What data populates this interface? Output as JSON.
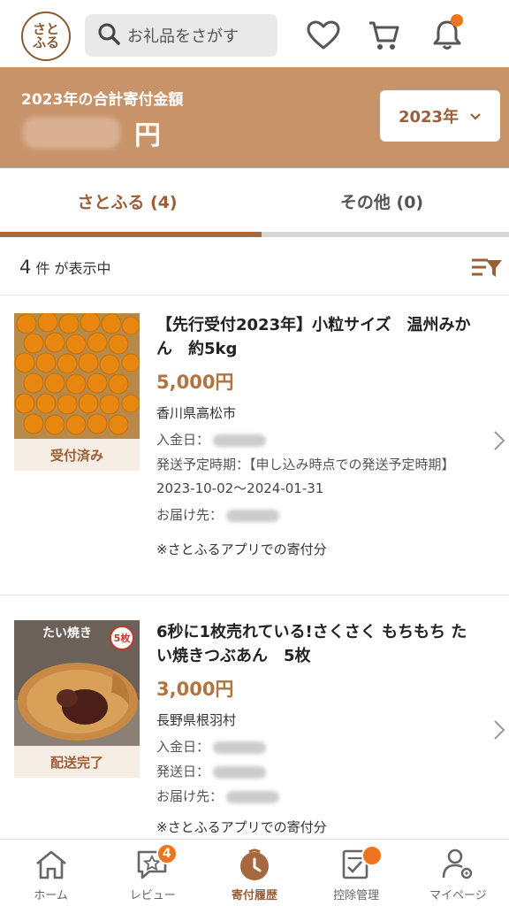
{
  "header": {
    "logo_text": "さとふる",
    "search_placeholder": "お礼品をさがす",
    "icons": [
      "search-icon",
      "heart-icon",
      "cart-icon",
      "bell-icon"
    ]
  },
  "summary": {
    "label": "2023年の合計寄付金額",
    "currency": "円",
    "year_select": "2023年"
  },
  "tabs": [
    {
      "label": "さとふる (4)",
      "active": true
    },
    {
      "label": "その他 (0)",
      "active": false
    }
  ],
  "list": {
    "count": "4",
    "count_suffix": "件 が表示中"
  },
  "items": [
    {
      "title": "【先行受付2023年】小粒サイズ　温州みかん　約5kg",
      "price": "5,000円",
      "municipality": "香川県高松市",
      "status": "受付済み",
      "payment_label": "入金日：",
      "shipping_label": "発送予定時期：【申し込み時点での発送予定時期】",
      "shipping_dates": "2023-10-02〜2024-01-31",
      "delivery_label": "お届け先：",
      "note": "※さとふるアプリでの寄付分"
    },
    {
      "title": "6秒に1枚売れている!さくさく もちもち たい焼きつぶあん　5枚",
      "price": "3,000円",
      "municipality": "長野県根羽村",
      "status": "配送完了",
      "image_text": "たい焼き",
      "image_badge": "5枚",
      "payment_label": "入金日：",
      "shipping_label": "発送日：",
      "delivery_label": "お届け先：",
      "note": "※さとふるアプリでの寄付分"
    }
  ],
  "bottom_nav": [
    {
      "label": "ホーム",
      "icon": "home-icon"
    },
    {
      "label": "レビュー",
      "icon": "review-icon",
      "badge": "4"
    },
    {
      "label": "寄付履歴",
      "icon": "donation-history-icon",
      "active": true
    },
    {
      "label": "控除管理",
      "icon": "deduction-icon"
    },
    {
      "label": "マイページ",
      "icon": "mypage-icon"
    }
  ],
  "colors": {
    "brand": "#a6693f",
    "summary_bg": "#c9936a",
    "accent_orange": "#f0731e",
    "status_bg": "#f6ede4"
  }
}
